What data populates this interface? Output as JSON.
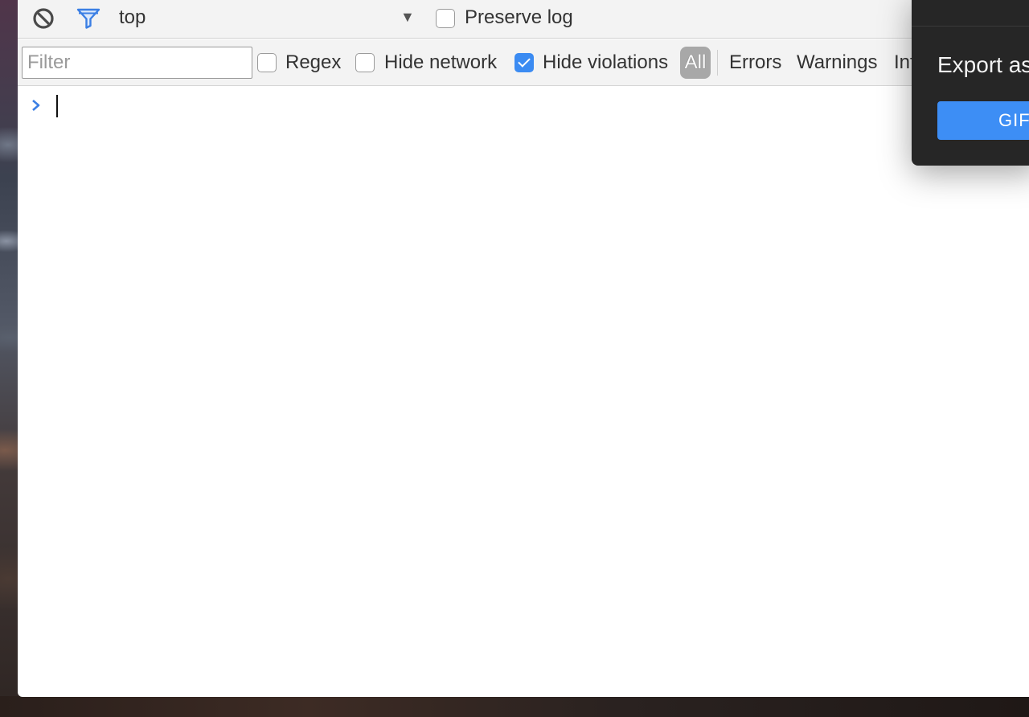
{
  "toolbar": {
    "context": "top",
    "preserve_log": {
      "label": "Preserve log",
      "checked": false
    }
  },
  "filter_bar": {
    "filter_placeholder": "Filter",
    "regex": {
      "label": "Regex",
      "checked": false
    },
    "hide_network": {
      "label": "Hide network",
      "checked": false
    },
    "hide_violations": {
      "label": "Hide violations",
      "checked": true
    },
    "levels": {
      "all": "All",
      "errors": "Errors",
      "warnings": "Warnings",
      "info": "Info"
    }
  },
  "export_popup": {
    "title": "Export as",
    "gif_button": "GIF"
  },
  "colors": {
    "accent": "#3b8bf2",
    "popup_bg": "#262626",
    "gif_button": "#3d8ef5"
  },
  "icons": {
    "clear": "block-icon",
    "filter": "funnel-icon",
    "prompt": "chevron-right-icon",
    "context_dropdown": "triangle-down-icon"
  }
}
